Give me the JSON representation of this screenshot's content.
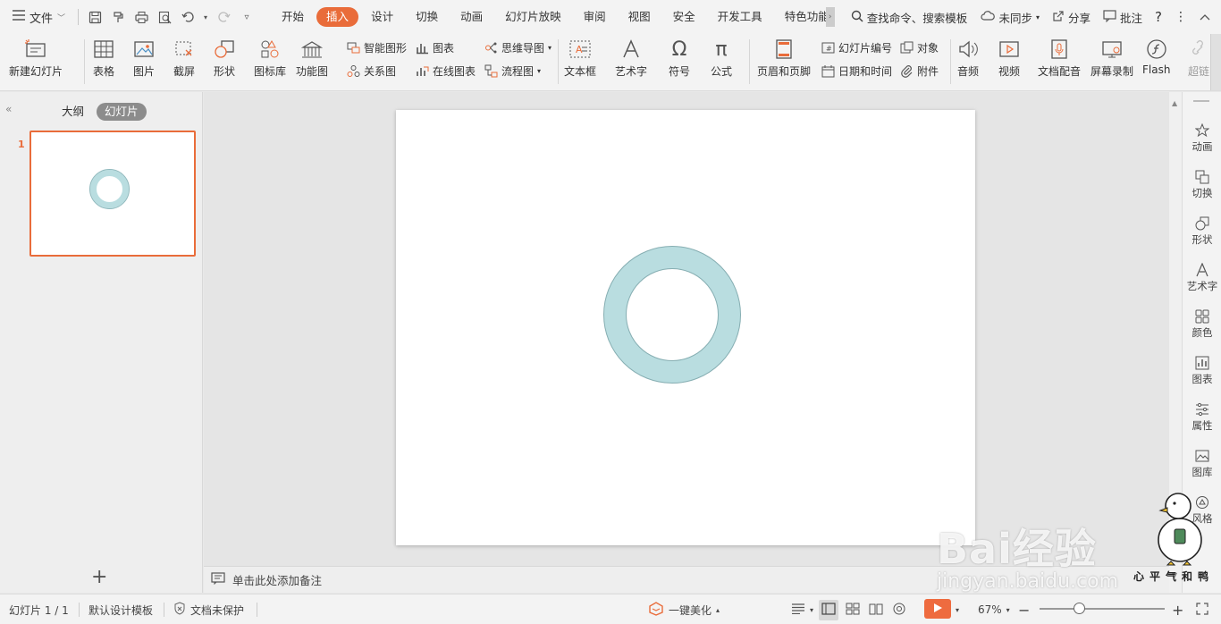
{
  "menubar": {
    "file_label": "文件",
    "tabs": [
      "开始",
      "插入",
      "设计",
      "切换",
      "动画",
      "幻灯片放映",
      "审阅",
      "视图",
      "安全",
      "开发工具",
      "特色功能"
    ],
    "active_tab_index": 1,
    "search_label": "查找命令、搜索模板",
    "sync_label": "未同步",
    "share_label": "分享",
    "comment_label": "批注",
    "help_label": "?"
  },
  "ribbon": {
    "new_slide": "新建幻灯片",
    "table": "表格",
    "picture": "图片",
    "screenshot": "截屏",
    "shape": "形状",
    "icon_lib": "图标库",
    "func_chart": "功能图",
    "smart_shape": "智能图形",
    "chart": "图表",
    "relation": "关系图",
    "online_chart": "在线图表",
    "mindmap": "思维导图",
    "flowchart": "流程图",
    "textbox": "文本框",
    "wordart": "艺术字",
    "symbol": "符号",
    "formula": "公式",
    "header_footer": "页眉和页脚",
    "slide_number": "幻灯片编号",
    "object": "对象",
    "datetime": "日期和时间",
    "attachment": "附件",
    "audio": "音频",
    "video": "视频",
    "doc_audio": "文档配音",
    "screen_record": "屏幕录制",
    "flash": "Flash",
    "hyperlink": "超链"
  },
  "left_panel": {
    "outline_tab": "大纲",
    "slides_tab": "幻灯片",
    "slide_number": "1",
    "add_symbol": "+"
  },
  "notes": {
    "placeholder": "单击此处添加备注"
  },
  "right_sidebar": {
    "items": [
      "动画",
      "切换",
      "形状",
      "艺术字",
      "颜色",
      "图表",
      "属性",
      "图库",
      "风格"
    ]
  },
  "statusbar": {
    "slide_info": "幻灯片 1 / 1",
    "template": "默认设计模板",
    "protection": "文档未保护",
    "beautify": "一键美化",
    "zoom": "67%",
    "zoom_level_fraction": 0.27
  },
  "watermark": {
    "brand": "Bai经验",
    "url": "jingyan.baidu.com",
    "caption": "心平气和鸭"
  },
  "colors": {
    "accent": "#e96c3a",
    "ring_fill": "#b9dde0",
    "ring_stroke": "#86aeb2",
    "play_button": "#ee6b3f"
  }
}
